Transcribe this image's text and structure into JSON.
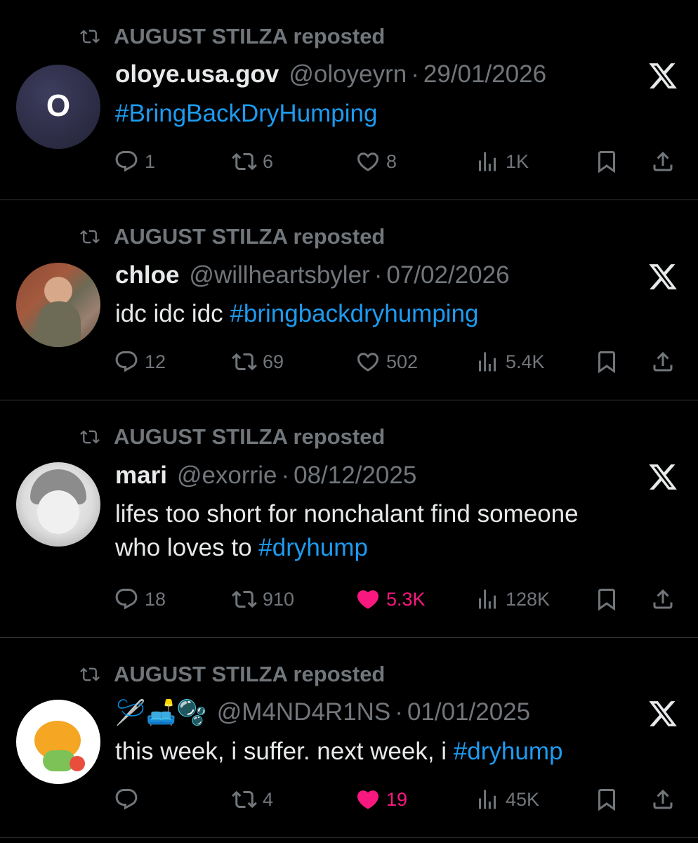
{
  "tweets": [
    {
      "repost_label": "AUGUST STILZA reposted",
      "name": "oloye.usa.gov",
      "handle": "@oloyeyrn",
      "separator": "·",
      "date": "29/01/2026",
      "avatar_letter": "O",
      "text_plain": "",
      "hashtag": "#BringBackDryHumping",
      "text_plain_2": "",
      "replies": "1",
      "reposts": "6",
      "likes": "8",
      "liked": false,
      "views": "1K"
    },
    {
      "repost_label": "AUGUST STILZA reposted",
      "name": "chloe",
      "handle": "@willheartsbyler",
      "separator": "·",
      "date": "07/02/2026",
      "text_plain": "idc idc idc ",
      "hashtag": "#bringbackdryhumping",
      "replies": "12",
      "reposts": "69",
      "likes": "502",
      "liked": false,
      "views": "5.4K"
    },
    {
      "repost_label": "AUGUST STILZA reposted",
      "name": "mari",
      "handle": "@exorrie",
      "separator": "·",
      "date": "08/12/2025",
      "text_line1": "lifes too short for nonchalant find someone",
      "text_line2": "who loves to ",
      "hashtag": "#dryhump",
      "replies": "18",
      "reposts": "910",
      "likes": "5.3K",
      "liked": true,
      "views": "128K"
    },
    {
      "repost_label": "AUGUST STILZA reposted",
      "name": "🪡🛋️🫧",
      "handle": "@M4ND4R1NS",
      "separator": "·",
      "date": "01/01/2025",
      "text_plain": "this week, i suffer. next week, i ",
      "hashtag": "#dryhump",
      "replies": "",
      "reposts": "4",
      "likes": "19",
      "liked": true,
      "views": "45K"
    }
  ],
  "colors": {
    "background": "#000000",
    "text": "#e7e9ea",
    "muted": "#71767b",
    "link": "#1d9bf0",
    "like_active": "#f91880",
    "divider": "#2f3336"
  },
  "icons": [
    "repost-icon",
    "reply-icon",
    "like-icon",
    "views-icon",
    "bookmark-icon",
    "share-icon",
    "x-logo-icon"
  ]
}
